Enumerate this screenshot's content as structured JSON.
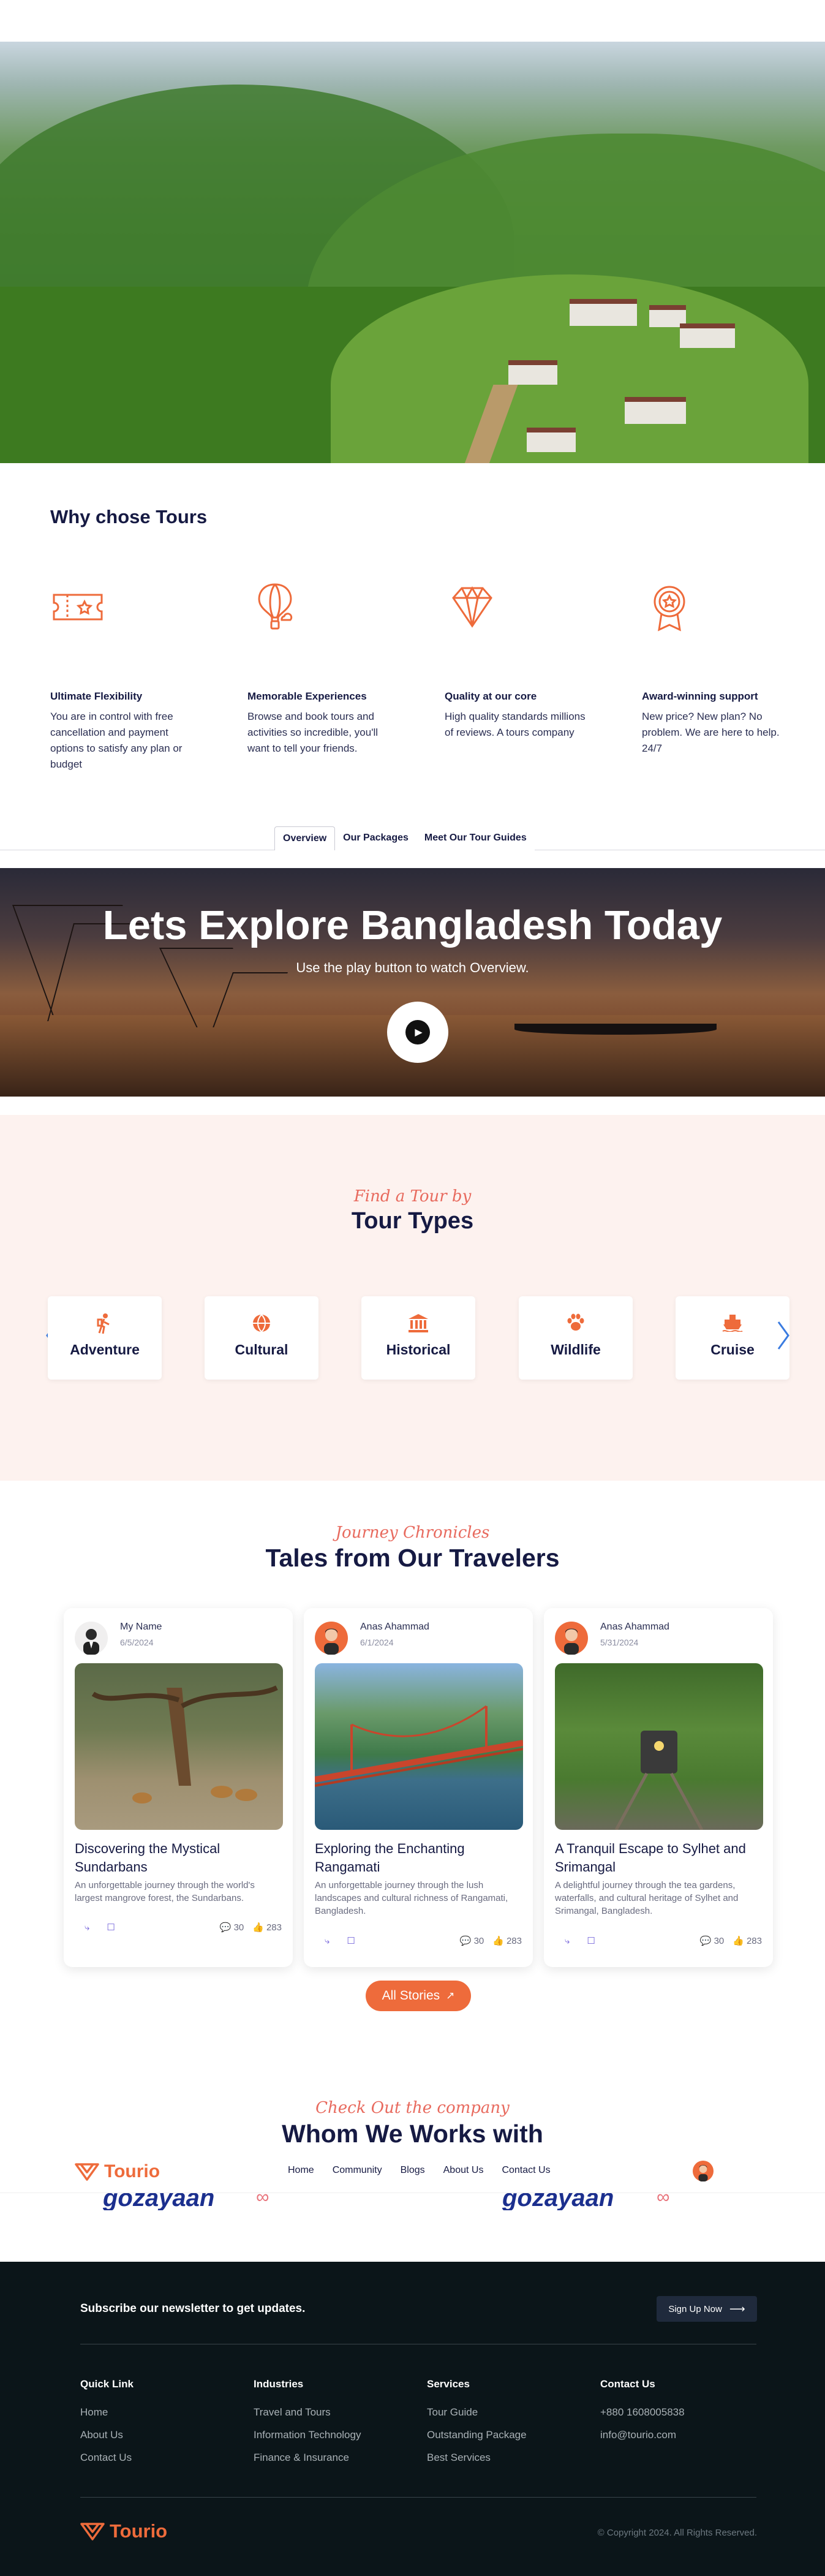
{
  "why": {
    "title": "Why chose Tours",
    "features": [
      {
        "icon": "ticket-icon",
        "title": "Ultimate Flexibility",
        "desc": "You are in control with free cancellation and payment options to satisfy any plan or budget"
      },
      {
        "icon": "hot-air-balloon-icon",
        "title": "Memorable Experiences",
        "desc": "Browse and book tours and activities so incredible, you'll want to tell your friends."
      },
      {
        "icon": "diamond-icon",
        "title": "Quality at our core",
        "desc": "High quality standards millions of reviews. A tours company"
      },
      {
        "icon": "award-badge-icon",
        "title": "Award-winning support",
        "desc": "New price? New plan? No problem. We are here to help. 24/7"
      }
    ]
  },
  "tabs": [
    "Overview",
    "Our Packages",
    "Meet Our Tour Guides"
  ],
  "explore": {
    "title": "Lets Explore Bangladesh Today",
    "subtitle": "Use the play button to watch Overview."
  },
  "tour_types": {
    "script": "Find a Tour by",
    "title": "Tour Types",
    "items": [
      {
        "label": "Adventure",
        "icon": "hiker-icon"
      },
      {
        "label": "Cultural",
        "icon": "globe-icon"
      },
      {
        "label": "Historical",
        "icon": "landmark-icon"
      },
      {
        "label": "Wildlife",
        "icon": "paw-icon"
      },
      {
        "label": "Cruise",
        "icon": "ship-icon"
      }
    ]
  },
  "tales": {
    "script": "Journey Chronicles",
    "title": "Tales from Our Travelers",
    "stories": [
      {
        "author": "My Name",
        "date": "6/5/2024",
        "title": "Discovering the Mystical Sundarbans",
        "desc": "An unforgettable journey through the world's largest mangrove forest, the Sundarbans.",
        "comments": "30",
        "likes": "283"
      },
      {
        "author": "Anas Ahammad",
        "date": "6/1/2024",
        "title": "Exploring the Enchanting Rangamati",
        "desc": "An unforgettable journey through the lush landscapes and cultural richness of Rangamati, Bangladesh.",
        "comments": "30",
        "likes": "283"
      },
      {
        "author": "Anas Ahammad",
        "date": "5/31/2024",
        "title": "A Tranquil Escape to Sylhet and Srimangal",
        "desc": "A delightful journey through the tea gardens, waterfalls, and cultural heritage of Sylhet and Srimangal, Bangladesh.",
        "comments": "30",
        "likes": "283"
      }
    ],
    "all_label": "All Stories"
  },
  "company": {
    "script": "Check Out the company",
    "title": "Whom We Works with",
    "partners": [
      "gozayaan",
      "gozayaan"
    ]
  },
  "navbar": {
    "brand": "Tourio",
    "links": [
      "Home",
      "Community",
      "Blogs",
      "About Us",
      "Contact Us"
    ]
  },
  "footer": {
    "newsletter": "Subscribe our newsletter to get updates.",
    "signup": "Sign Up Now",
    "columns": [
      {
        "title": "Quick Link",
        "items": [
          "Home",
          "About Us",
          "Contact Us"
        ]
      },
      {
        "title": "Industries",
        "items": [
          "Travel and Tours",
          "Information Technology",
          "Finance & Insurance"
        ]
      },
      {
        "title": "Services",
        "items": [
          "Tour Guide",
          "Outstanding Package",
          "Best Services"
        ]
      },
      {
        "title": "Contact Us",
        "items": [
          "+880 1608005838",
          "info@tourio.com"
        ]
      }
    ],
    "brand": "Tourio",
    "copyright": "© Copyright 2024. All Rights Reserved."
  },
  "colors": {
    "accent": "#ee6b3b",
    "navy": "#161a43",
    "footer_bg": "#0b1519",
    "types_bg": "#fdf2ef"
  }
}
